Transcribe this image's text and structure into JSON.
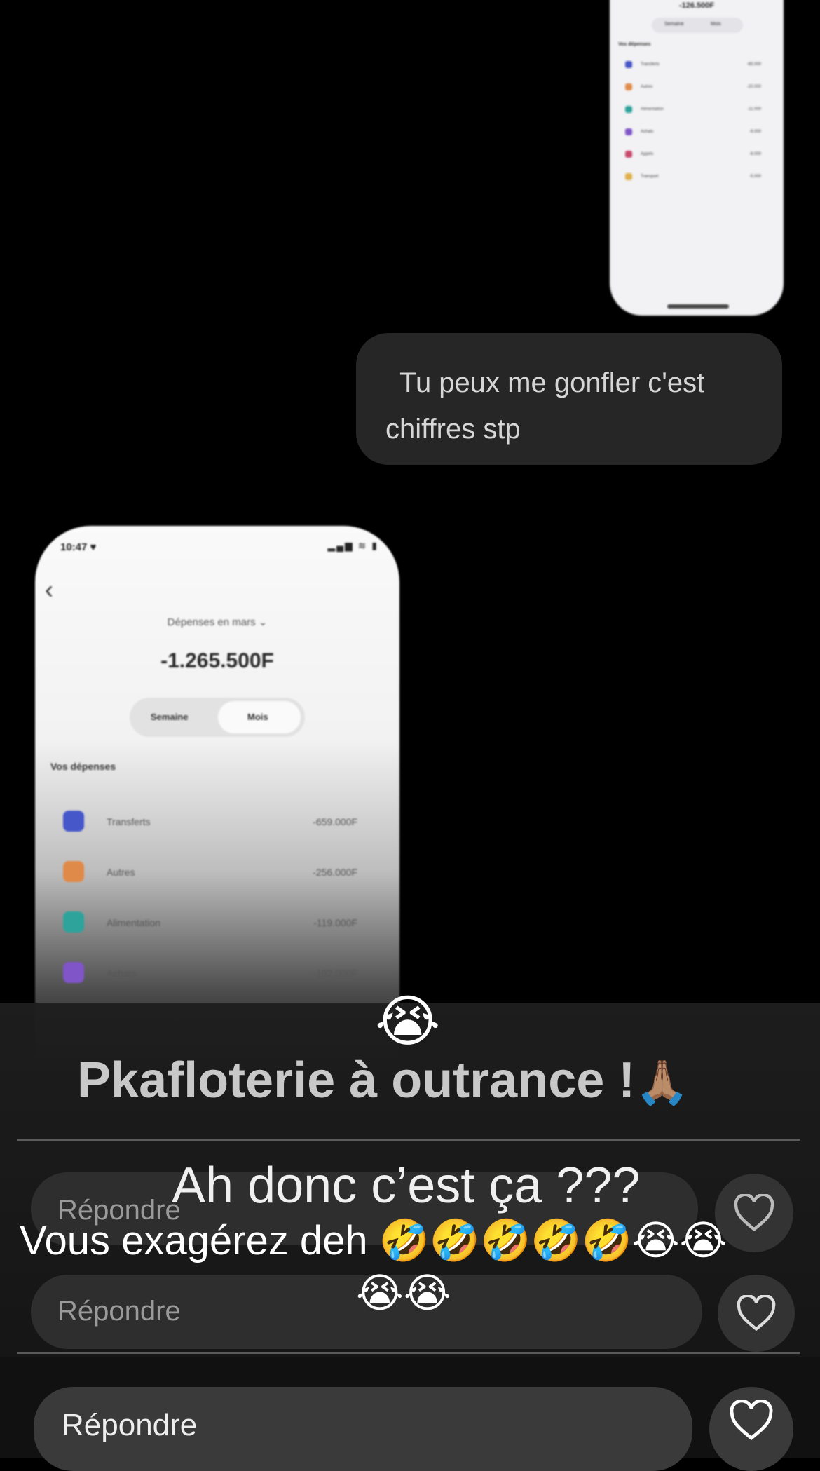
{
  "top_screenshot": {
    "total": "-126.500F",
    "tabs": [
      "Semaine",
      "Mois"
    ],
    "section": "Vos dépenses",
    "rows": [
      {
        "label": "Transferts",
        "amount": "-65.000",
        "color": "#4657c9"
      },
      {
        "label": "Autres",
        "amount": "-20.000",
        "color": "#e08a4a"
      },
      {
        "label": "Alimentation",
        "amount": "-11.000",
        "color": "#2ea39b"
      },
      {
        "label": "Achats",
        "amount": "-9.000",
        "color": "#7f55c7"
      },
      {
        "label": "Appels",
        "amount": "-8.000",
        "color": "#c94a6b"
      },
      {
        "label": "Transport",
        "amount": "-5.000",
        "color": "#e0b04a"
      }
    ]
  },
  "message_bubble": {
    "text_line1": "Tu peux me gonfler c'est",
    "text_line2": "chiffres stp"
  },
  "main_screenshot": {
    "status_time": "10:47 ♥",
    "status_icons": "▂▄▆ ≋ ▮",
    "back_glyph": "‹",
    "title": "Dépenses en mars ⌄",
    "total": "-1.265.500F",
    "tabs": [
      "Semaine",
      "Mois"
    ],
    "section": "Vos dépenses",
    "rows": [
      {
        "label": "Transferts",
        "amount": "-659.000F",
        "color": "#4657c9"
      },
      {
        "label": "Autres",
        "amount": "-256.000F",
        "color": "#e08a4a"
      },
      {
        "label": "Alimentation",
        "amount": "-119.000F",
        "color": "#2ea39b"
      },
      {
        "label": "Achats",
        "amount": "-102.000F",
        "color": "#7f55c7"
      }
    ]
  },
  "story_overlays": {
    "cry_emoji": "😭",
    "headline": "Pkafloterie à outrance !",
    "pray_emoji": "🙏🏽",
    "caption1": "Ah donc c’est ça ???",
    "caption2": "Vous exagérez deh 🤣🤣🤣🤣🤣😭😭",
    "caption2b": "😭😭",
    "reply_placeholder": "Répondre"
  }
}
